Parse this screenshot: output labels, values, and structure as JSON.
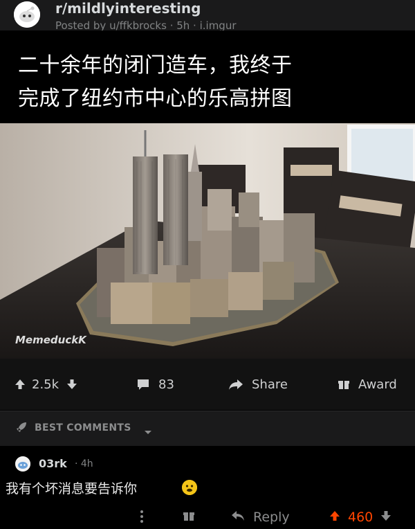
{
  "post": {
    "subreddit": "r/mildlyinteresting",
    "posted_line": "Posted by u/ffkbrocks · 5h · i.imgur"
  },
  "caption": {
    "line1": "二十余年的闭门造车，我终于",
    "line2": "完成了纽约市中心的乐高拼图"
  },
  "watermark": "MemeduckK",
  "actions": {
    "upvotes": "2.5k",
    "comments": "83",
    "share": "Share",
    "award": "Award"
  },
  "best_comments": {
    "label": "BEST COMMENTS"
  },
  "comment": {
    "user": "03rk",
    "age": "· 4h",
    "text": "我有个坏消息要告诉你",
    "reply": "Reply",
    "score": "460"
  },
  "colors": {
    "upvote": "#ff4500",
    "background": "#000000",
    "bar": "#121212"
  },
  "icons": [
    "reddit-avatar-icon",
    "upvote-icon",
    "downvote-icon",
    "comment-icon",
    "share-icon",
    "award-icon",
    "rocket-icon",
    "chevron-down-icon",
    "more-icon",
    "gift-icon",
    "reply-icon",
    "emoji-icon"
  ]
}
